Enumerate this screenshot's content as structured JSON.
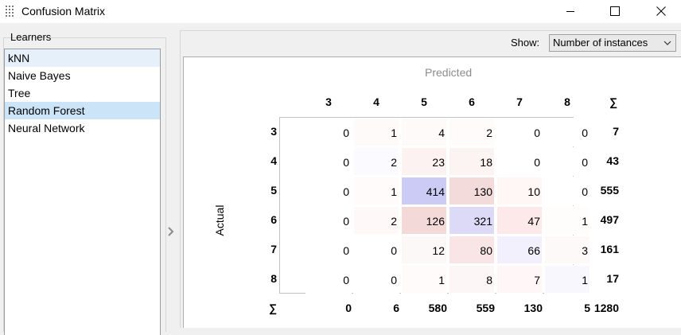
{
  "window": {
    "title": "Confusion Matrix",
    "icon": "confusion-matrix-app-icon",
    "controls": [
      "minimize-icon",
      "maximize-icon",
      "close-icon"
    ]
  },
  "learners": {
    "label": "Learners",
    "items": [
      {
        "label": "kNN",
        "state": "hover"
      },
      {
        "label": "Naive Bayes",
        "state": "normal"
      },
      {
        "label": "Tree",
        "state": "normal"
      },
      {
        "label": "Random Forest",
        "state": "selected"
      },
      {
        "label": "Neural Network",
        "state": "normal"
      }
    ]
  },
  "show": {
    "label": "Show:",
    "selected": "Number of instances"
  },
  "matrix": {
    "predicted_label": "Predicted",
    "actual_label": "Actual",
    "sum_symbol": "∑",
    "classes": [
      "3",
      "4",
      "5",
      "6",
      "7",
      "8"
    ],
    "rows": [
      {
        "label": "3",
        "values": [
          "0",
          "1",
          "4",
          "2",
          "0",
          "0"
        ],
        "sum": "7"
      },
      {
        "label": "4",
        "values": [
          "0",
          "2",
          "23",
          "18",
          "0",
          "0"
        ],
        "sum": "43"
      },
      {
        "label": "5",
        "values": [
          "0",
          "1",
          "414",
          "130",
          "10",
          "0"
        ],
        "sum": "555"
      },
      {
        "label": "6",
        "values": [
          "0",
          "2",
          "126",
          "321",
          "47",
          "1"
        ],
        "sum": "497"
      },
      {
        "label": "7",
        "values": [
          "0",
          "0",
          "12",
          "80",
          "66",
          "3"
        ],
        "sum": "161"
      },
      {
        "label": "8",
        "values": [
          "0",
          "0",
          "1",
          "8",
          "7",
          "1"
        ],
        "sum": "17"
      }
    ],
    "column_sums": [
      "0",
      "6",
      "580",
      "559",
      "130",
      "5"
    ],
    "total": "1280",
    "cell_colors": [
      [
        "#ffffff",
        "#fffafa",
        "#fffafa",
        "#fffbfb",
        "#ffffff",
        "#ffffff"
      ],
      [
        "#ffffff",
        "#fafaff",
        "#fcf2f2",
        "#fcf3f3",
        "#ffffff",
        "#ffffff"
      ],
      [
        "#ffffff",
        "#fffbfb",
        "#cccbf6",
        "#f3dbdb",
        "#fff6f6",
        "#ffffff"
      ],
      [
        "#ffffff",
        "#fff8f8",
        "#f4d9d9",
        "#dcdaf7",
        "#fde9e9",
        "#fffcfc"
      ],
      [
        "#ffffff",
        "#ffffff",
        "#fdf8f8",
        "#f9e5e5",
        "#f1f0fc",
        "#fdf9f9"
      ],
      [
        "#ffffff",
        "#ffffff",
        "#fffbfb",
        "#fdf6f6",
        "#fff7f7",
        "#f7f7fd"
      ]
    ]
  }
}
